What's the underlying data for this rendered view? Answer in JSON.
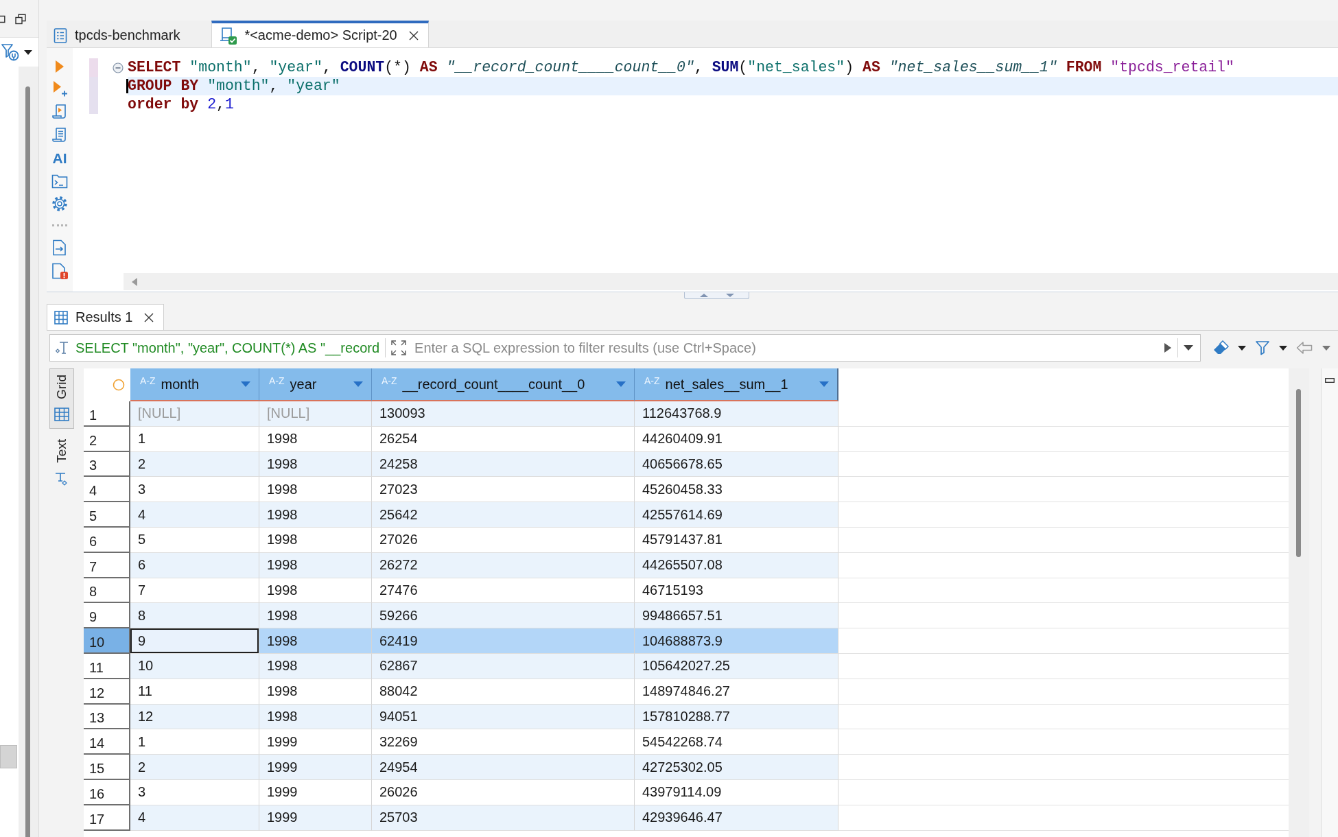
{
  "editor_tabs": [
    {
      "label": "tpcds-benchmark",
      "kind": "document",
      "selected": false,
      "closable": false
    },
    {
      "label": "*<acme-demo> Script-20",
      "kind": "script",
      "selected": true,
      "closable": true
    }
  ],
  "editor_toolbar": {
    "ai_label": "AI"
  },
  "editor": {
    "lines": [
      {
        "foldable": true,
        "current": false,
        "tokens": [
          {
            "kind": "keyword",
            "text": "SELECT "
          },
          {
            "kind": "string",
            "text": "\"month\""
          },
          {
            "kind": "plain",
            "text": ", "
          },
          {
            "kind": "string",
            "text": "\"year\""
          },
          {
            "kind": "plain",
            "text": ", "
          },
          {
            "kind": "function",
            "text": "COUNT"
          },
          {
            "kind": "plain",
            "text": "(*) "
          },
          {
            "kind": "keyword",
            "text": "AS "
          },
          {
            "kind": "alias",
            "text": "\"__record_count____count__0\""
          },
          {
            "kind": "plain",
            "text": ", "
          },
          {
            "kind": "function",
            "text": "SUM"
          },
          {
            "kind": "plain",
            "text": "("
          },
          {
            "kind": "string",
            "text": "\"net_sales\""
          },
          {
            "kind": "plain",
            "text": ") "
          },
          {
            "kind": "keyword",
            "text": "AS "
          },
          {
            "kind": "alias",
            "text": "\"net_sales__sum__1\""
          },
          {
            "kind": "keyword",
            "text": " FROM "
          },
          {
            "kind": "table",
            "text": "\"tpcds_retail\""
          }
        ]
      },
      {
        "foldable": false,
        "current": true,
        "tokens": [
          {
            "kind": "keyword",
            "text": "GROUP BY "
          },
          {
            "kind": "string",
            "text": "\"month\""
          },
          {
            "kind": "plain",
            "text": ", "
          },
          {
            "kind": "string",
            "text": "\"year\""
          }
        ]
      },
      {
        "foldable": false,
        "current": false,
        "tokens": [
          {
            "kind": "keyword",
            "text": "order by "
          },
          {
            "kind": "number",
            "text": "2"
          },
          {
            "kind": "plain",
            "text": ","
          },
          {
            "kind": "number",
            "text": "1"
          }
        ]
      }
    ]
  },
  "results": {
    "tabs": [
      {
        "label": "Results 1",
        "selected": true,
        "closable": true
      }
    ],
    "filter": {
      "query": "SELECT \"month\", \"year\", COUNT(*) AS \"__record",
      "placeholder": "Enter a SQL expression to filter results (use Ctrl+Space)"
    },
    "view_modes": [
      {
        "label": "Grid",
        "kind": "grid",
        "selected": true
      },
      {
        "label": "Text",
        "kind": "text",
        "selected": false
      }
    ],
    "columns": [
      {
        "type_label": "A-Z",
        "name": "month"
      },
      {
        "type_label": "A-Z",
        "name": "year"
      },
      {
        "type_label": "A-Z",
        "name": "__record_count____count__0"
      },
      {
        "type_label": "A-Z",
        "name": "net_sales__sum__1"
      }
    ],
    "rows": [
      {
        "number": "1",
        "selected": false,
        "cells": [
          {
            "text": "[NULL]",
            "is_null": true,
            "focused": false
          },
          {
            "text": "[NULL]",
            "is_null": true,
            "focused": false
          },
          {
            "text": "130093",
            "is_null": false,
            "focused": false
          },
          {
            "text": "112643768.9",
            "is_null": false,
            "focused": false
          }
        ]
      },
      {
        "number": "2",
        "selected": false,
        "cells": [
          {
            "text": "1",
            "is_null": false,
            "focused": false
          },
          {
            "text": "1998",
            "is_null": false,
            "focused": false
          },
          {
            "text": "26254",
            "is_null": false,
            "focused": false
          },
          {
            "text": "44260409.91",
            "is_null": false,
            "focused": false
          }
        ]
      },
      {
        "number": "3",
        "selected": false,
        "cells": [
          {
            "text": "2",
            "is_null": false,
            "focused": false
          },
          {
            "text": "1998",
            "is_null": false,
            "focused": false
          },
          {
            "text": "24258",
            "is_null": false,
            "focused": false
          },
          {
            "text": "40656678.65",
            "is_null": false,
            "focused": false
          }
        ]
      },
      {
        "number": "4",
        "selected": false,
        "cells": [
          {
            "text": "3",
            "is_null": false,
            "focused": false
          },
          {
            "text": "1998",
            "is_null": false,
            "focused": false
          },
          {
            "text": "27023",
            "is_null": false,
            "focused": false
          },
          {
            "text": "45260458.33",
            "is_null": false,
            "focused": false
          }
        ]
      },
      {
        "number": "5",
        "selected": false,
        "cells": [
          {
            "text": "4",
            "is_null": false,
            "focused": false
          },
          {
            "text": "1998",
            "is_null": false,
            "focused": false
          },
          {
            "text": "25642",
            "is_null": false,
            "focused": false
          },
          {
            "text": "42557614.69",
            "is_null": false,
            "focused": false
          }
        ]
      },
      {
        "number": "6",
        "selected": false,
        "cells": [
          {
            "text": "5",
            "is_null": false,
            "focused": false
          },
          {
            "text": "1998",
            "is_null": false,
            "focused": false
          },
          {
            "text": "27026",
            "is_null": false,
            "focused": false
          },
          {
            "text": "45791437.81",
            "is_null": false,
            "focused": false
          }
        ]
      },
      {
        "number": "7",
        "selected": false,
        "cells": [
          {
            "text": "6",
            "is_null": false,
            "focused": false
          },
          {
            "text": "1998",
            "is_null": false,
            "focused": false
          },
          {
            "text": "26272",
            "is_null": false,
            "focused": false
          },
          {
            "text": "44265507.08",
            "is_null": false,
            "focused": false
          }
        ]
      },
      {
        "number": "8",
        "selected": false,
        "cells": [
          {
            "text": "7",
            "is_null": false,
            "focused": false
          },
          {
            "text": "1998",
            "is_null": false,
            "focused": false
          },
          {
            "text": "27476",
            "is_null": false,
            "focused": false
          },
          {
            "text": "46715193",
            "is_null": false,
            "focused": false
          }
        ]
      },
      {
        "number": "9",
        "selected": false,
        "cells": [
          {
            "text": "8",
            "is_null": false,
            "focused": false
          },
          {
            "text": "1998",
            "is_null": false,
            "focused": false
          },
          {
            "text": "59266",
            "is_null": false,
            "focused": false
          },
          {
            "text": "99486657.51",
            "is_null": false,
            "focused": false
          }
        ]
      },
      {
        "number": "10",
        "selected": true,
        "cells": [
          {
            "text": "9",
            "is_null": false,
            "focused": true
          },
          {
            "text": "1998",
            "is_null": false,
            "focused": false
          },
          {
            "text": "62419",
            "is_null": false,
            "focused": false
          },
          {
            "text": "104688873.9",
            "is_null": false,
            "focused": false
          }
        ]
      },
      {
        "number": "11",
        "selected": false,
        "cells": [
          {
            "text": "10",
            "is_null": false,
            "focused": false
          },
          {
            "text": "1998",
            "is_null": false,
            "focused": false
          },
          {
            "text": "62867",
            "is_null": false,
            "focused": false
          },
          {
            "text": "105642027.25",
            "is_null": false,
            "focused": false
          }
        ]
      },
      {
        "number": "12",
        "selected": false,
        "cells": [
          {
            "text": "11",
            "is_null": false,
            "focused": false
          },
          {
            "text": "1998",
            "is_null": false,
            "focused": false
          },
          {
            "text": "88042",
            "is_null": false,
            "focused": false
          },
          {
            "text": "148974846.27",
            "is_null": false,
            "focused": false
          }
        ]
      },
      {
        "number": "13",
        "selected": false,
        "cells": [
          {
            "text": "12",
            "is_null": false,
            "focused": false
          },
          {
            "text": "1998",
            "is_null": false,
            "focused": false
          },
          {
            "text": "94051",
            "is_null": false,
            "focused": false
          },
          {
            "text": "157810288.77",
            "is_null": false,
            "focused": false
          }
        ]
      },
      {
        "number": "14",
        "selected": false,
        "cells": [
          {
            "text": "1",
            "is_null": false,
            "focused": false
          },
          {
            "text": "1999",
            "is_null": false,
            "focused": false
          },
          {
            "text": "32269",
            "is_null": false,
            "focused": false
          },
          {
            "text": "54542268.74",
            "is_null": false,
            "focused": false
          }
        ]
      },
      {
        "number": "15",
        "selected": false,
        "cells": [
          {
            "text": "2",
            "is_null": false,
            "focused": false
          },
          {
            "text": "1999",
            "is_null": false,
            "focused": false
          },
          {
            "text": "24954",
            "is_null": false,
            "focused": false
          },
          {
            "text": "42725302.05",
            "is_null": false,
            "focused": false
          }
        ]
      },
      {
        "number": "16",
        "selected": false,
        "cells": [
          {
            "text": "3",
            "is_null": false,
            "focused": false
          },
          {
            "text": "1999",
            "is_null": false,
            "focused": false
          },
          {
            "text": "26026",
            "is_null": false,
            "focused": false
          },
          {
            "text": "43979114.09",
            "is_null": false,
            "focused": false
          }
        ]
      },
      {
        "number": "17",
        "selected": false,
        "cells": [
          {
            "text": "4",
            "is_null": false,
            "focused": false
          },
          {
            "text": "1999",
            "is_null": false,
            "focused": false
          },
          {
            "text": "25703",
            "is_null": false,
            "focused": false
          },
          {
            "text": "42939646.47",
            "is_null": false,
            "focused": false
          }
        ]
      }
    ]
  }
}
